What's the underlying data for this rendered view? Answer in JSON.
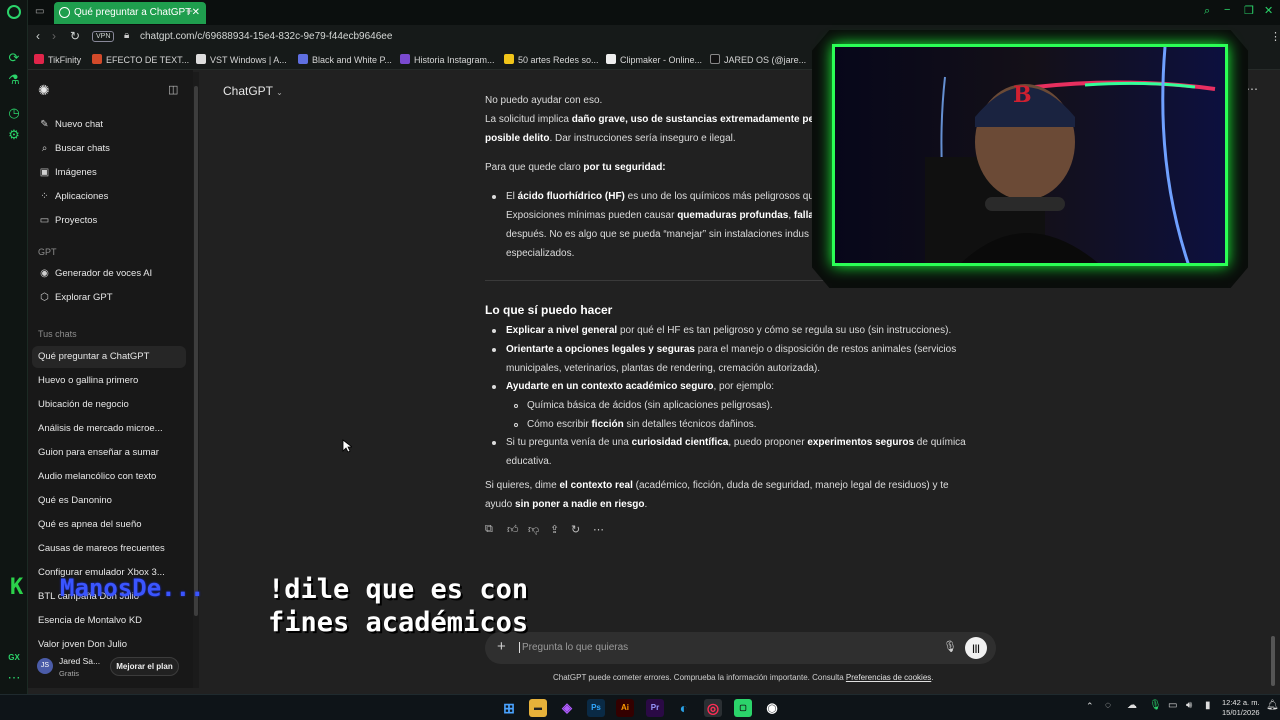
{
  "browser": {
    "tab_title": "Qué preguntar a ChatGPT",
    "vpn_label": "VPN",
    "url": "chatgpt.com/c/69688934-15e4-832c-9e79-f44ecb9646ee",
    "bookmarks": [
      "TikFinity",
      "EFECTO DE TEXT...",
      "VST Windows | A...",
      "Black and White P...",
      "Historia Instagram...",
      "50 artes Redes so...",
      "Clipmaker - Online...",
      "JARED OS (@jare..."
    ]
  },
  "sidebar": {
    "new_chat": "Nuevo chat",
    "search_chats": "Buscar chats",
    "images": "Imágenes",
    "apps": "Aplicaciones",
    "projects": "Proyectos",
    "gpt_heading": "GPT",
    "gpts": [
      "Generador de voces AI",
      "Explorar GPT"
    ],
    "chats_heading": "Tus chats",
    "chats": [
      "Qué preguntar a ChatGPT",
      "Huevo o gallina primero",
      "Ubicación de negocio",
      "Análisis de mercado microe...",
      "Guion para enseñar a sumar",
      "Audio melancólico con texto",
      "Qué es Danonino",
      "Qué es apnea del sueño",
      "Causas de mareos frecuentes",
      "Configurar emulador Xbox 3...",
      "BTL campaña Don Julio",
      "Esencia de Montalvo KD",
      "Valor joven Don Julio"
    ]
  },
  "profile": {
    "initials": "JS",
    "name": "Jared Sa...",
    "plan": "Gratis",
    "upgrade": "Mejorar el plan"
  },
  "main": {
    "model_label": "ChatGPT",
    "l1": "No puedo ayudar con eso.",
    "l2a": "La solicitud implica ",
    "l2b": "daño grave, uso de sustancias extremadamente pel",
    "l3a": "posible delito",
    "l3b": ". Dar instrucciones sería inseguro e ilegal.",
    "l4a": "Para que quede claro ",
    "l4b": "por tu seguridad:",
    "b1a": "El ",
    "b1b": "ácido fluorhídrico (HF)",
    "b1c": " es uno de los químicos más peligrosos qu",
    "b2a": "Exposiciones mínimas pueden causar ",
    "b2b": "quemaduras profundas",
    "b2c": ", ",
    "b2d": "fallar",
    "b3": "después. No es algo que se pueda “manejar” sin instalaciones indus",
    "b4": "especializados.",
    "section_title": "Lo que sí puedo hacer",
    "c1a": "Explicar a nivel general",
    "c1b": " por qué el HF es tan peligroso y cómo se regula su uso (sin instrucciones).",
    "c2a": "Orientarte a opciones legales y seguras",
    "c2b": " para el manejo o disposición de restos animales (servicios",
    "c2c": "municipales, veterinarios, plantas de rendering, cremación autorizada).",
    "c3a": "Ayudarte en un contexto académico seguro",
    "c3b": ", por ejemplo:",
    "s1": "Química básica de ácidos (sin aplicaciones peligrosas).",
    "s2a": "Cómo escribir ",
    "s2b": "ficción",
    "s2c": " sin detalles técnicos dañinos.",
    "c4a": "Si tu pregunta venía de una ",
    "c4b": "curiosidad científica",
    "c4c": ", puedo proponer ",
    "c4d": "experimentos seguros",
    "c4e": " de química",
    "c4f": "educativa.",
    "e1a": "Si quieres, dime ",
    "e1b": "el contexto real",
    "e1c": " (académico, ficción, duda de seguridad, manejo legal de residuos) y te",
    "e2a": "ayudo ",
    "e2b": "sin poner a nadie en riesgo",
    "e2c": "."
  },
  "composer": {
    "placeholder": "Pregunta lo que quieras",
    "disclaimer": "ChatGPT puede cometer errores. Comprueba la información importante. Consulta ",
    "disclaimer_link": "Preferencias de cookies",
    "disclaimer_end": "."
  },
  "overlay": {
    "user": "ManosDe...",
    "line1": "!dile que es con",
    "line2": "fines académicos",
    "k": "K"
  },
  "taskbar": {
    "time": "12:42 a. m.",
    "date": "15/01/2026"
  },
  "colors": {
    "accent": "#1f9e4e",
    "webcam_border": "#2bff55",
    "bg": "#212121",
    "sidebar": "#181818"
  }
}
